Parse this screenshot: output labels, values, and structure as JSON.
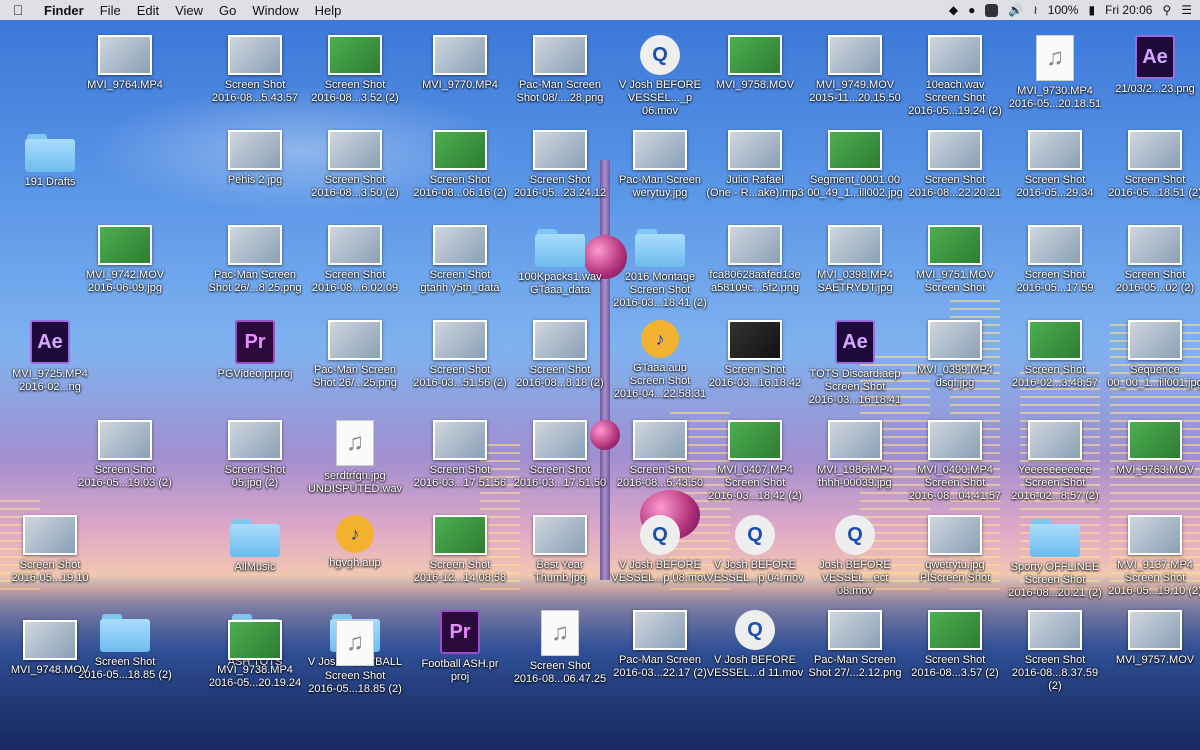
{
  "menubar": {
    "apple_icon": "apple-logo",
    "app_name": "Finder",
    "menus": [
      "File",
      "Edit",
      "View",
      "Go",
      "Window",
      "Help"
    ],
    "battery": "100%",
    "clock": "Fri 20:06"
  },
  "desktop_items": [
    {
      "kind": "thumb",
      "label": "MVI_9764.MP4"
    },
    {
      "kind": "thumb",
      "label": "Screen Shot\n2016-08...5.43.57"
    },
    {
      "kind": "thumb",
      "label": "Screen Shot\n2016-08...3.52 (2)"
    },
    {
      "kind": "thumb",
      "label": "MVI_9770.MP4"
    },
    {
      "kind": "thumb",
      "label": "Pac-Man Screen\nShot 08/....28.png"
    },
    {
      "kind": "qt",
      "label": "V Josh BEFORE\nVESSEL..._p 06.mov"
    },
    {
      "kind": "thumb",
      "label": "MVI_9758.MOV"
    },
    {
      "kind": "thumb",
      "label": "MVI_9749.MOV\n2015-11...20.15.50"
    },
    {
      "kind": "thumb",
      "label": "10each.wav\nScreen Shot\n2016-05...19.24 (2)"
    },
    {
      "kind": "doc",
      "label": "MVI_9730.MP4\n2016-05...20.18.51"
    },
    {
      "kind": "ae",
      "label": "21/03/2...23.png"
    },
    {
      "kind": "folder",
      "label": "191 Drafts"
    },
    {
      "kind": "thumb",
      "label": "Pehis 2.jpg"
    },
    {
      "kind": "thumb",
      "label": "Screen Shot\n2016-08...3.50 (2)"
    },
    {
      "kind": "thumb",
      "label": "Screen Shot\n2016-08...06.16 (2)"
    },
    {
      "kind": "thumb",
      "label": "Screen Shot\n2016-05...23.24.12"
    },
    {
      "kind": "thumb",
      "label": "Pac-Man Screen\nwerytuy.jpg"
    },
    {
      "kind": "thumb",
      "label": "Julio Rafael\n(One - R...ake).mp3"
    },
    {
      "kind": "thumb",
      "label": "Segment_0001.00\n00_49_1...ill002.jpg"
    },
    {
      "kind": "thumb",
      "label": "Screen Shot\n2016-08...22.20.21"
    },
    {
      "kind": "thumb",
      "label": "Screen Shot\n2016-05...29.34"
    },
    {
      "kind": "thumb",
      "label": "Screen Shot\n2016-05...18.51 (2)"
    },
    {
      "kind": "thumb",
      "label": "MVI_9742.MOV\n2016-06-09.jpg"
    },
    {
      "kind": "thumb",
      "label": "Pac-Man Screen\nShot 26/...8.25.png"
    },
    {
      "kind": "thumb",
      "label": "Screen Shot\n2016-08...6.02.09"
    },
    {
      "kind": "thumb",
      "label": "Screen Shot\ngtahh y5th_data"
    },
    {
      "kind": "folder",
      "label": "100Kpacks1.wav\nGTaaa_data"
    },
    {
      "kind": "folder",
      "label": "2016 Montage\nScreen Shot\n2016-03...18.41 (2)"
    },
    {
      "kind": "thumb",
      "label": "fca80628aafed13e\na58109c...5f2.png"
    },
    {
      "kind": "thumb",
      "label": "MVI_0398.MP4\nSAETRYDT.jpg"
    },
    {
      "kind": "thumb",
      "label": "MVI_9751.MOV\nScreen Shot"
    },
    {
      "kind": "thumb",
      "label": "Screen Shot\n2016-05...17.59"
    },
    {
      "kind": "thumb",
      "label": "Screen Shot\n2016-05...02 (2)"
    },
    {
      "kind": "ae",
      "label": "MVI_9725.MP4\n2016-02...ng"
    },
    {
      "kind": "pr",
      "label": "PGVideo.prproj"
    },
    {
      "kind": "thumb",
      "label": "Pac-Man Screen\nShot 26/...25.png"
    },
    {
      "kind": "thumb",
      "label": "Screen Shot\n2016-03...51.56 (2)"
    },
    {
      "kind": "thumb",
      "label": "Screen Shot\n2016-08...8.18 (2)"
    },
    {
      "kind": "au",
      "label": "GTaaa.aup\nScreen Shot\n2016-04...22.58.31"
    },
    {
      "kind": "dark",
      "label": "Screen Shot\n2016-03...16.18.42"
    },
    {
      "kind": "ae",
      "label": "TOTS Discard.aep\nScreen Shot\n2016-03...16.18.41"
    },
    {
      "kind": "thumb",
      "label": "MVI_0399.MP4\ndsgf.jpg"
    },
    {
      "kind": "thumb",
      "label": "Screen Shot\n2016-02...3.48.57"
    },
    {
      "kind": "thumb",
      "label": "Sequence\n00_00_1...ill001.jpg"
    },
    {
      "kind": "thumb",
      "label": "Screen Shot\n2016-05...19.03 (2)"
    },
    {
      "kind": "thumb",
      "label": "Screen Shot\n05.jpg (2)"
    },
    {
      "kind": "doc",
      "label": "serdtrfgh.jpg\nUNDISPUTED.wav"
    },
    {
      "kind": "thumb",
      "label": "Screen Shot\n2016-03...17.51.56"
    },
    {
      "kind": "thumb",
      "label": "Screen Shot\n2016-03...17.51.50"
    },
    {
      "kind": "thumb",
      "label": "Screen Shot\n2016-08...5.43.50"
    },
    {
      "kind": "thumb",
      "label": "MVI_0407.MP4\nScreen Shot\n2016-03...18.42 (2)"
    },
    {
      "kind": "thumb",
      "label": "MVI_1986.MP4\nthhh-00039.jpg"
    },
    {
      "kind": "thumb",
      "label": "MVI_0400.MP4\nScreen Shot\n2016-08...04.41.57"
    },
    {
      "kind": "thumb",
      "label": "Yeeeeeeeeeee\nScreen Shot\n2016-02...8.57 (2)"
    },
    {
      "kind": "thumb",
      "label": "MVI_9763.MOV"
    },
    {
      "kind": "thumb",
      "label": "Screen Shot\n2016-05...19.10"
    },
    {
      "kind": "folder",
      "label": "AllMusic"
    },
    {
      "kind": "au",
      "label": "hgvgh.aup"
    },
    {
      "kind": "thumb",
      "label": "Screen Shot\n2016-12...14.08.58"
    },
    {
      "kind": "thumb",
      "label": "Best Year\nThumb.jpg"
    },
    {
      "kind": "qt",
      "label": "V Josh BEFORE\nVESSEL...p 08.mov"
    },
    {
      "kind": "qt",
      "label": "V Josh BEFORE\nVESSEL...p 04.mov"
    },
    {
      "kind": "qt",
      "label": "Josh BEFORE\nVESSEL...ect 08.mov"
    },
    {
      "kind": "thumb",
      "label": "qwetrytu.jpg\nPlScreen Shot"
    },
    {
      "kind": "folder",
      "label": "Sporty OFFLINEE\nScreen Shot\n2016-08...20.21 (2)"
    },
    {
      "kind": "thumb",
      "label": "MVI_9137.MP4\nScreen Shot\n2016-05...19.10 (2)"
    },
    {
      "kind": "folder",
      "label": "Screen Shot\n2016-05...18.85 (2)"
    },
    {
      "kind": "folder",
      "label": "ASH TOTS"
    },
    {
      "kind": "folder",
      "label": "V Josh FOOTBALL"
    },
    {
      "kind": "pr",
      "label": "Football ASH.pr\nproj"
    },
    {
      "kind": "doc",
      "label": "Screen Shot\n2016-08...06.47.25"
    },
    {
      "kind": "thumb",
      "label": "Pac-Man Screen\n2016-03...22.17 (2)"
    },
    {
      "kind": "qt",
      "label": "V Josh BEFORE\nVESSEL...d 11.mov"
    },
    {
      "kind": "thumb",
      "label": "Pac-Man Screen\nShot 27/...2.12.png"
    },
    {
      "kind": "thumb",
      "label": "Screen Shot\n2016-08...3.57 (2)"
    },
    {
      "kind": "thumb",
      "label": "Screen Shot\n2016-08...8.37.59 (2)"
    },
    {
      "kind": "thumb",
      "label": "MVI_9757.MOV"
    },
    {
      "kind": "thumb",
      "label": "MVI_9748.MOV"
    },
    {
      "kind": "thumb",
      "label": "MVI_9738.MP4\n2016-05...20.19.24"
    },
    {
      "kind": "doc",
      "label": "Screen Shot\n2016-05...18.85 (2)"
    }
  ]
}
